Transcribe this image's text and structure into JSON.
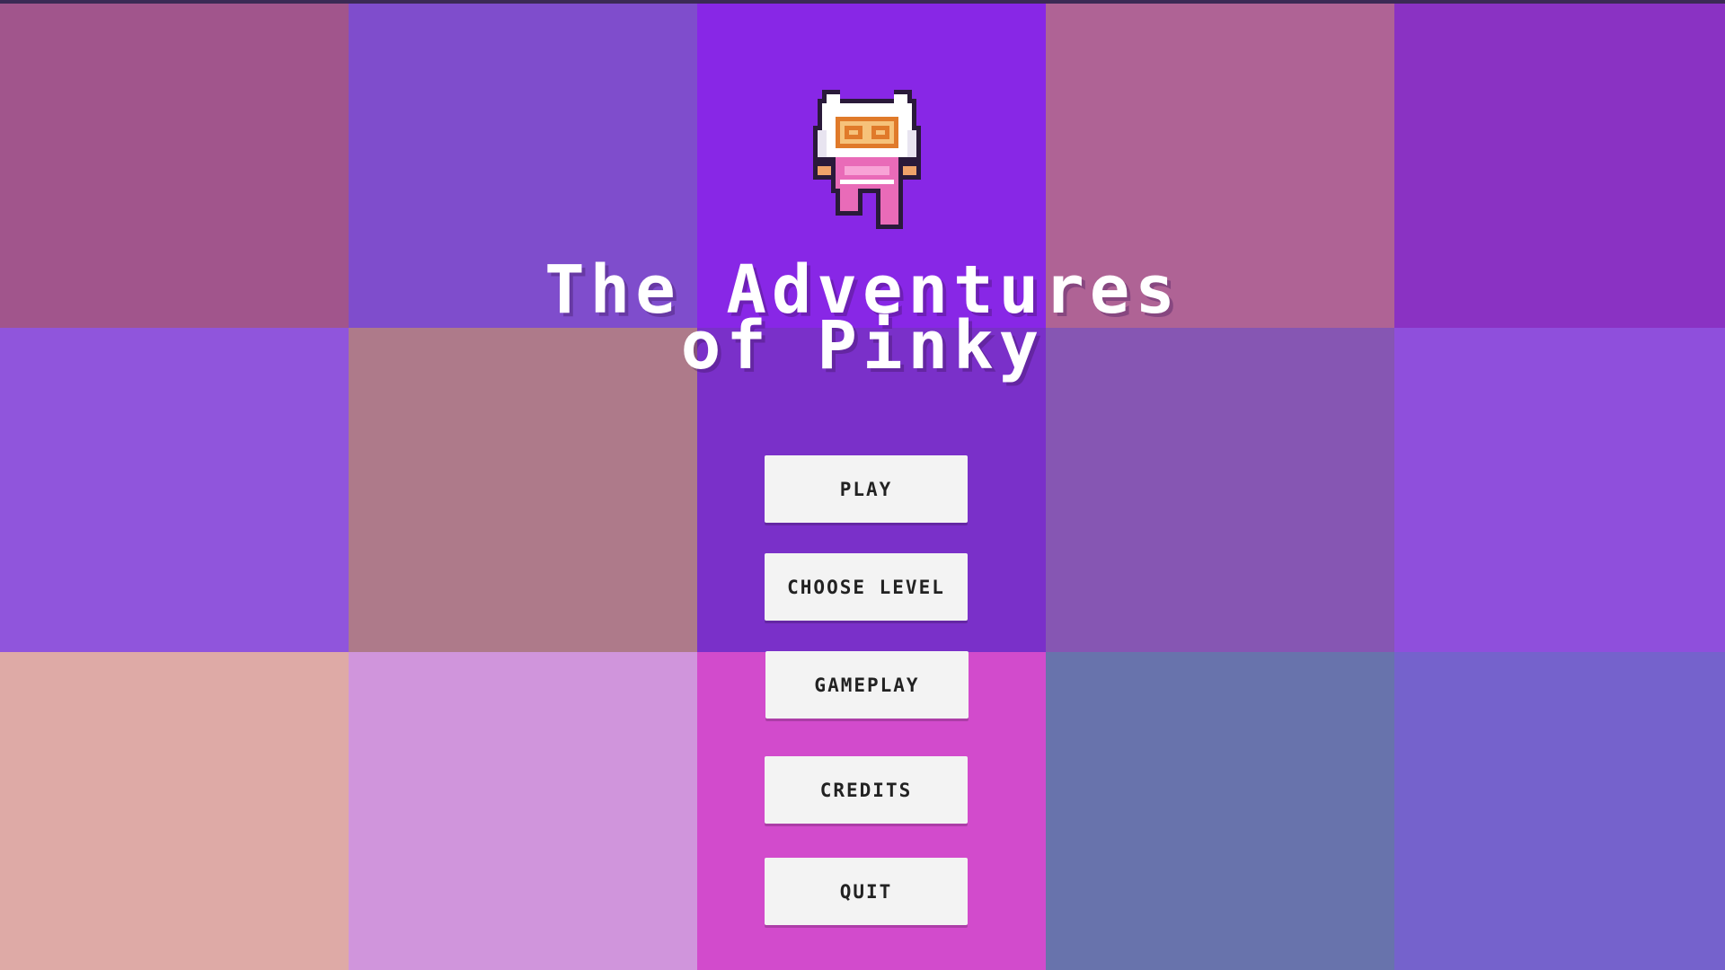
{
  "title": {
    "line1": "The Adventures",
    "line2": "of Pinky"
  },
  "menu": {
    "play": "PLAY",
    "choose_level": "CHOOSE LEVEL",
    "gameplay": "GAMEPLAY",
    "credits": "CREDITS",
    "quit": "QUIT"
  },
  "background_tiles": [
    [
      "#a1558c",
      "#7f4dcc",
      "#8827e6",
      "#af6395",
      "#8a32c3"
    ],
    [
      "#9055dc",
      "#ae7a8a",
      "#7a30c9",
      "#8656b3",
      "#8f4fdc"
    ],
    [
      "#deaaa6",
      "#d095dc",
      "#d24bcc",
      "#6873ac",
      "#7562cc"
    ]
  ],
  "colors": {
    "button_bg": "#f3f3f3",
    "button_text": "#222222",
    "title_text": "#ffffff"
  },
  "icons": {
    "character": "pinky-astronaut-sprite"
  }
}
